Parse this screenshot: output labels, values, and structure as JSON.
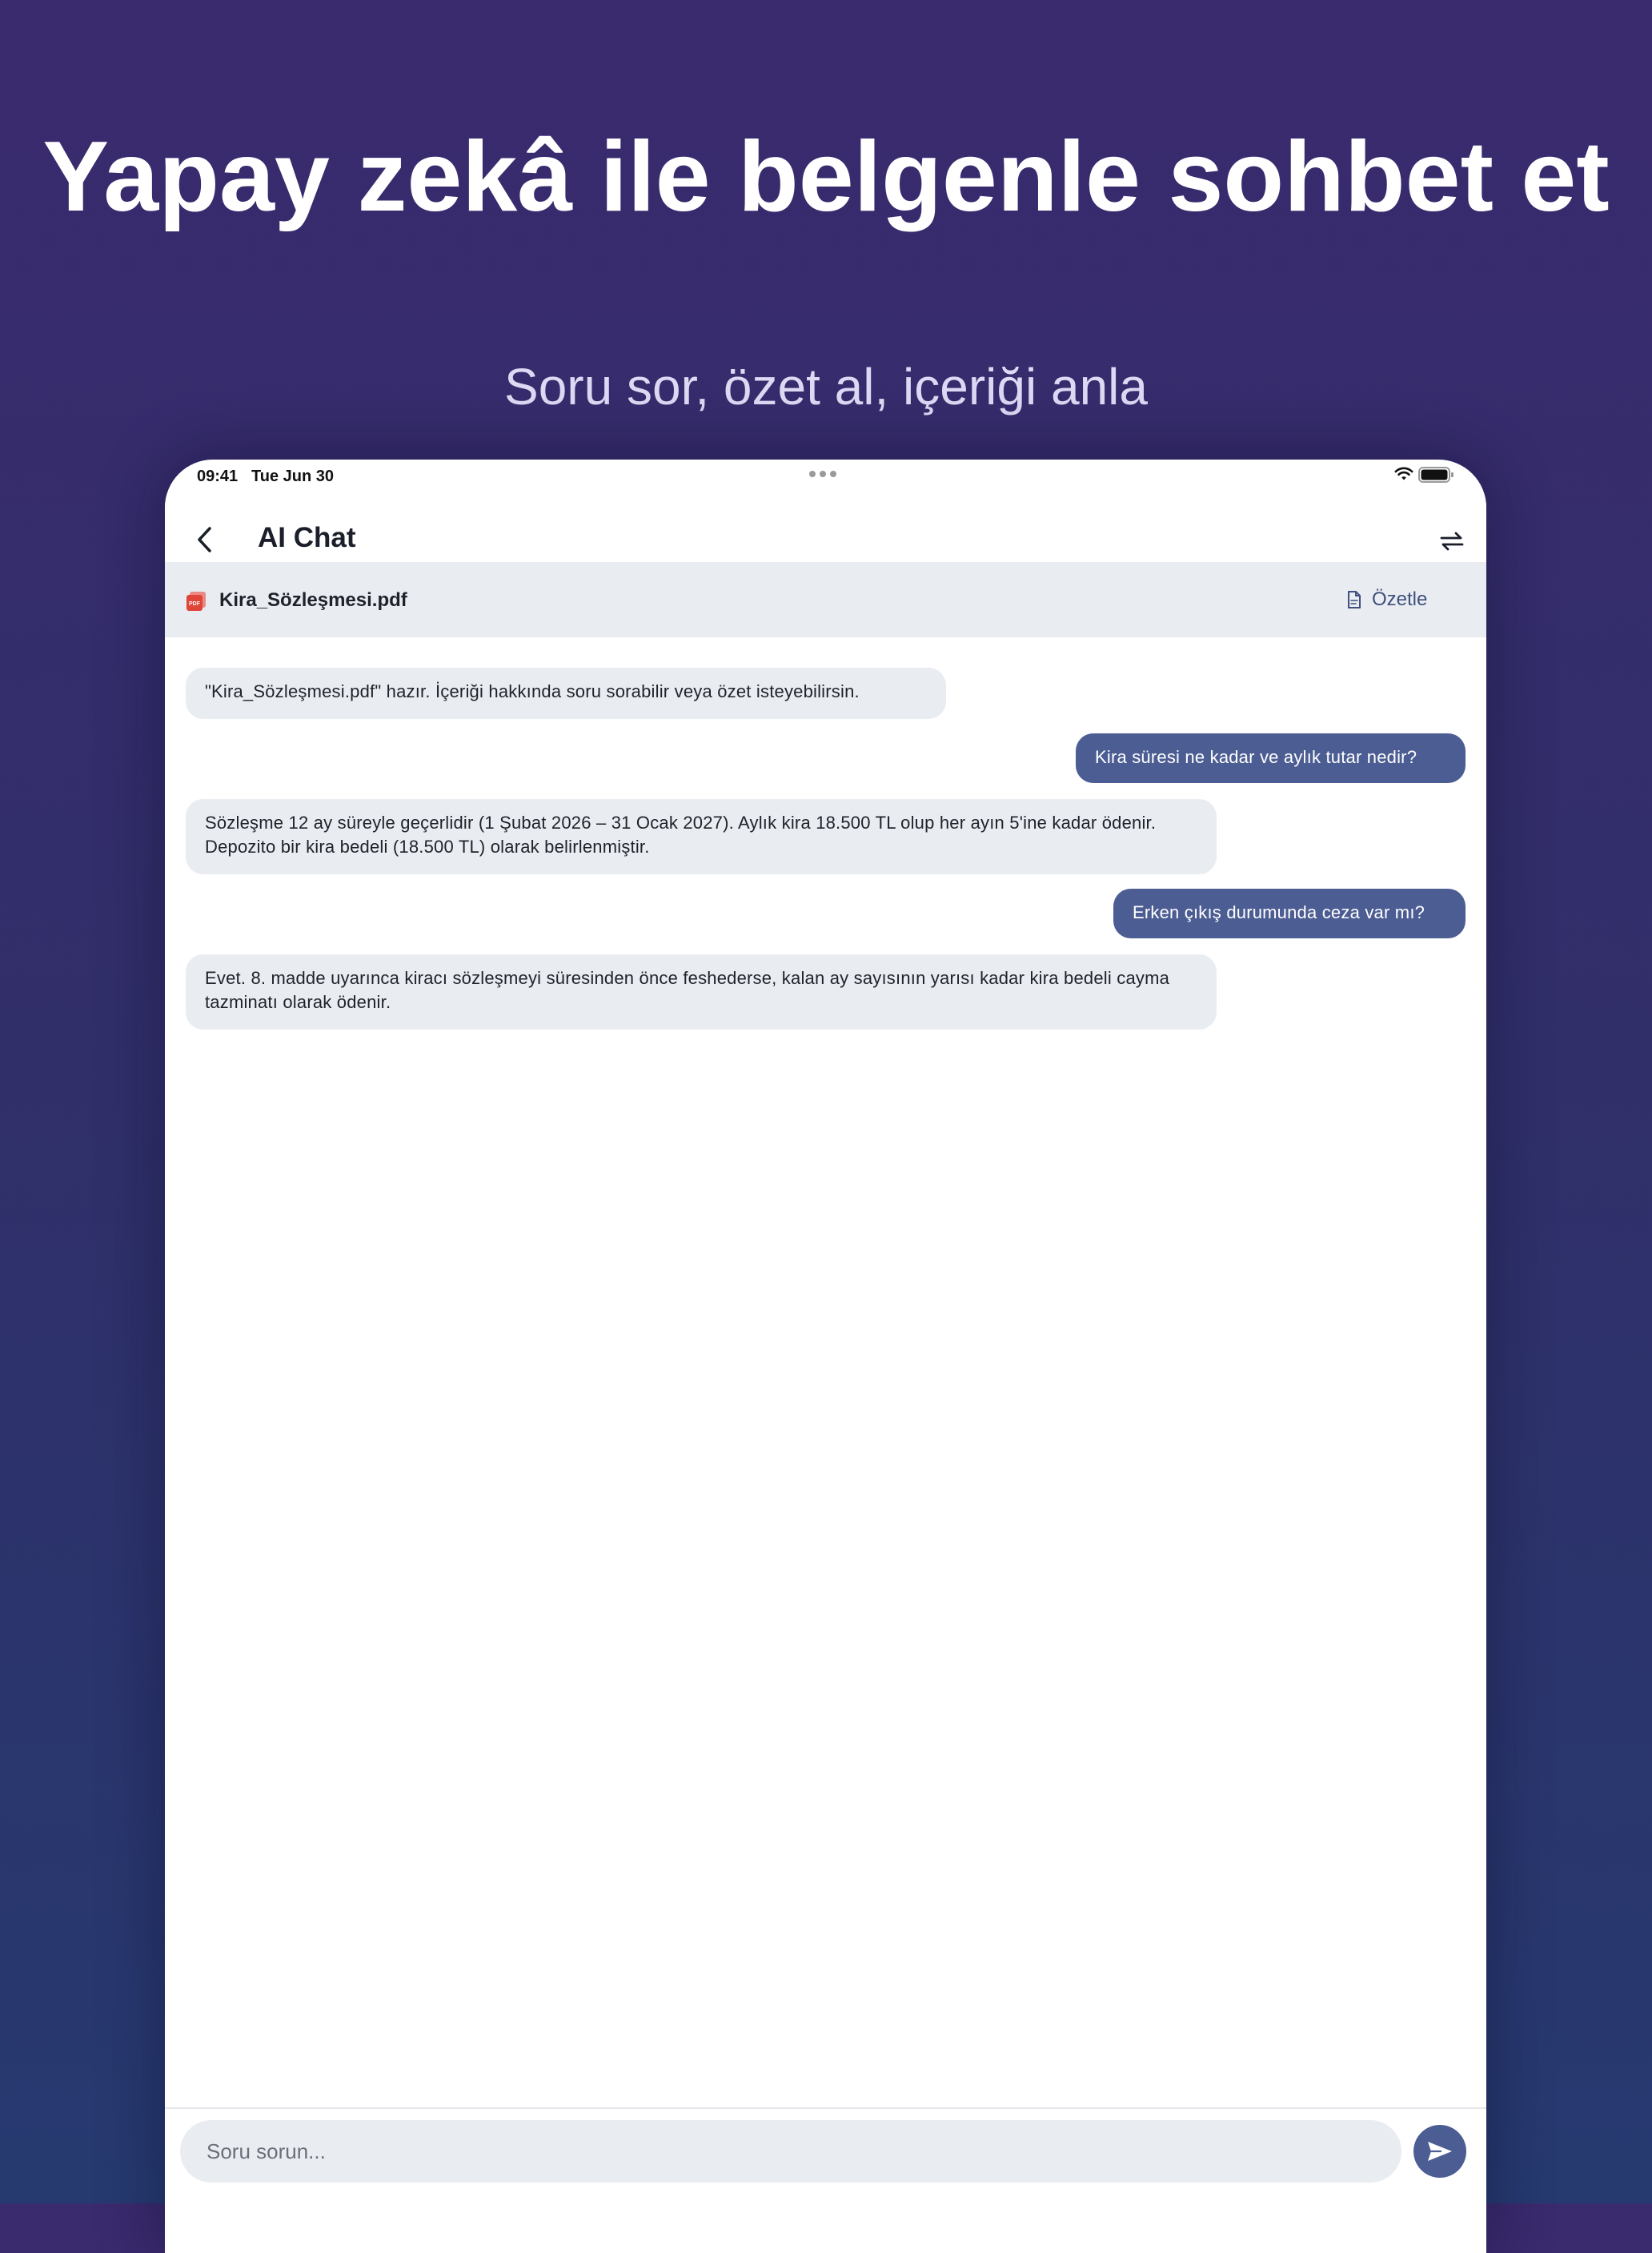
{
  "hero": {
    "title": "Yapay zekâ ile belgenle sohbet et",
    "subtitle": "Soru sor, özet al, içeriği anla"
  },
  "status_bar": {
    "time": "09:41",
    "date": "Tue Jun 30"
  },
  "nav": {
    "title": "AI Chat",
    "back_icon": "chevron-left-icon",
    "swap_icon": "swap-arrows-icon"
  },
  "document": {
    "name": "Kira_Sözleşmesi.pdf",
    "icon": "pdf-icon",
    "summarize_label": "Özetle",
    "summarize_icon": "document-icon"
  },
  "messages": [
    {
      "role": "ai",
      "text": "\"Kira_Sözleşmesi.pdf\" hazır. İçeriği hakkında soru sorabilir veya özet isteyebilirsin."
    },
    {
      "role": "user",
      "text": "Kira süresi ne kadar ve aylık tutar nedir?"
    },
    {
      "role": "ai",
      "text": "Sözleşme 12 ay süreyle geçerlidir (1 Şubat 2026 – 31 Ocak 2027). Aylık kira 18.500 TL olup her ayın 5'ine kadar ödenir. Depozito bir kira bedeli (18.500 TL) olarak belirlenmiştir."
    },
    {
      "role": "user",
      "text": "Erken çıkış durumunda ceza var mı?"
    },
    {
      "role": "ai",
      "text": "Evet. 8. madde uyarınca kiracı sözleşmeyi süresinden önce feshederse, kalan ay sayısının yarısı kadar kira bedeli cayma tazminatı olarak ödenir."
    }
  ],
  "composer": {
    "placeholder": "Soru sorun...",
    "send_icon": "send-icon"
  },
  "colors": {
    "accent": "#4c5d93",
    "bubble_ai": "#e9ecf1",
    "pdf_red": "#e0453a"
  }
}
